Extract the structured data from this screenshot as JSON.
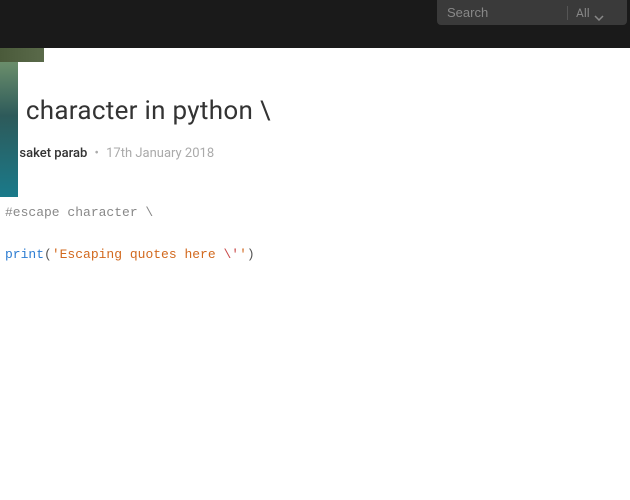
{
  "search": {
    "placeholder": "Search",
    "filter_label": "All"
  },
  "post": {
    "title": "e character in python \\",
    "by_label": "y",
    "author": "saket parab",
    "date": "17th January 2018"
  },
  "code": {
    "comment": "#escape character \\",
    "keyword": "print",
    "paren_open": "(",
    "string_main": "'Escaping quotes here ",
    "escape_seq": "\\'",
    "string_end": "'",
    "paren_close": ")"
  }
}
